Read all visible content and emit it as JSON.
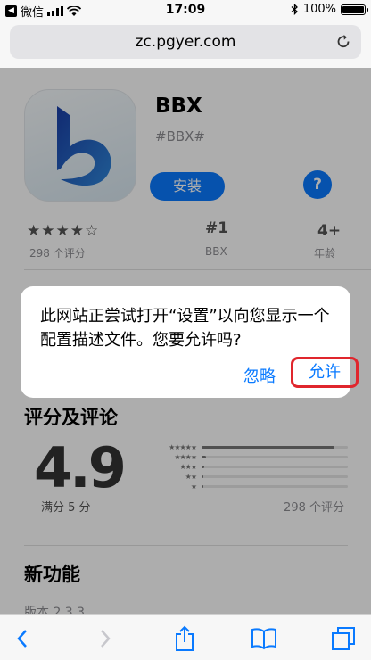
{
  "status_bar": {
    "carrier": "微信",
    "time": "17:09",
    "battery": "100%"
  },
  "address_bar": {
    "url": "zc.pgyer.com"
  },
  "app": {
    "name": "BBX",
    "subtitle": "#BBX#",
    "install_label": "安装",
    "help_label": "?",
    "stars": "★★★★☆",
    "rating_count": "298 个评分",
    "rank": "#1",
    "rank_sub": "BBX",
    "age": "4+",
    "age_sub": "年龄"
  },
  "ratings": {
    "section_title": "评分及评论",
    "score": "4.9",
    "score_sub": "满分 5 分",
    "total": "298 个评分",
    "distribution": [
      0.91,
      0.03,
      0.02,
      0.01,
      0.01
    ],
    "star_labels": [
      "★★★★★",
      "★★★★",
      "★★★",
      "★★",
      "★"
    ]
  },
  "whats_new": {
    "title": "新功能",
    "version": "版本 2.3.3"
  },
  "alert": {
    "message": "此网站正尝试打开“设置”以向您显示一个配置描述文件。您要允许吗?",
    "ignore_label": "忽略",
    "allow_label": "允许"
  },
  "colors": {
    "accent": "#0a7aff",
    "highlight": "#e0262d"
  }
}
